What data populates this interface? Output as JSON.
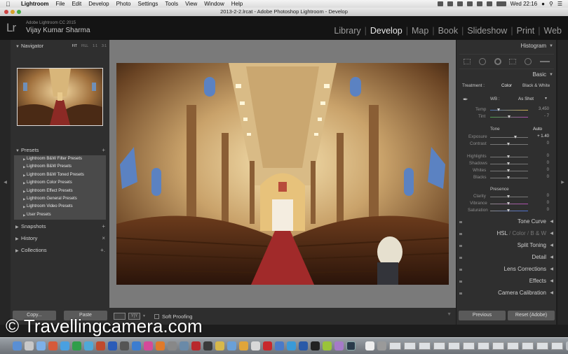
{
  "menubar": {
    "apple": "",
    "items": [
      "Lightroom",
      "File",
      "Edit",
      "Develop",
      "Photo",
      "Settings",
      "Tools",
      "View",
      "Window",
      "Help"
    ],
    "clock": "Wed 22:16"
  },
  "window": {
    "title": "2013-2-2.lrcat - Adobe Photoshop Lightroom - Develop"
  },
  "identity": {
    "logo": "Lr",
    "app": "Adobe Lightroom CC 2015",
    "user": "Vijay Kumar Sharma"
  },
  "modules": {
    "items": [
      "Library",
      "Develop",
      "Map",
      "Book",
      "Slideshow",
      "Print",
      "Web"
    ],
    "active": "Develop"
  },
  "left_panel": {
    "navigator": {
      "label": "Navigator",
      "zoom": [
        "FIT",
        "FILL",
        "1:1",
        "3:1"
      ]
    },
    "presets": {
      "label": "Presets",
      "add": "+",
      "items": [
        "Lightroom B&W Filter Presets",
        "Lightroom B&W Presets",
        "Lightroom B&W Toned Presets",
        "Lightroom Color Presets",
        "Lightroom Effect Presets",
        "Lightroom General Presets",
        "Lightroom Video Presets",
        "User Presets"
      ]
    },
    "snapshots": {
      "label": "Snapshots",
      "add": "+"
    },
    "history": {
      "label": "History",
      "close": "×"
    },
    "collections": {
      "label": "Collections",
      "add": "+."
    },
    "copy_label": "Copy...",
    "paste_label": "Paste"
  },
  "toolbar": {
    "soft_proofing": "Soft Proofing",
    "yy": "Y|Y"
  },
  "right_panel": {
    "histogram": "Histogram",
    "basic": {
      "label": "Basic",
      "treatment_label": "Treatment :",
      "treatment_color": "Color",
      "treatment_bw": "Black & White",
      "wb_label": "WB :",
      "wb_value": "As Shot",
      "temp": {
        "label": "Temp",
        "value": "3,450"
      },
      "tint": {
        "label": "Tint",
        "value": "- 7"
      },
      "tone_label": "Tone",
      "auto_label": "Auto",
      "exposure": {
        "label": "Exposure",
        "value": "+ 1.40"
      },
      "contrast": {
        "label": "Contrast",
        "value": "0"
      },
      "highlights": {
        "label": "Highlights",
        "value": "0"
      },
      "shadows": {
        "label": "Shadows",
        "value": "0"
      },
      "whites": {
        "label": "Whites",
        "value": "0"
      },
      "blacks": {
        "label": "Blacks",
        "value": "0"
      },
      "presence_label": "Presence",
      "clarity": {
        "label": "Clarity",
        "value": "0"
      },
      "vibrance": {
        "label": "Vibrance",
        "value": "0"
      },
      "saturation": {
        "label": "Saturation",
        "value": "0"
      }
    },
    "tone_curve": "Tone Curve",
    "hsl": "HSL",
    "color": "Color",
    "bw": "B & W",
    "hsl_sep": "/",
    "split_toning": "Split Toning",
    "detail": "Detail",
    "lens_corrections": "Lens Corrections",
    "effects": "Effects",
    "camera_calibration": "Camera Calibration",
    "previous_label": "Previous",
    "reset_label": "Reset (Adobe)"
  },
  "watermark": "© Travellingcamera.com",
  "colors": {
    "panel": "#2f2f2f",
    "center": "#7a7a7a",
    "identity": "#141414",
    "active_module": "#e8e8e8"
  }
}
